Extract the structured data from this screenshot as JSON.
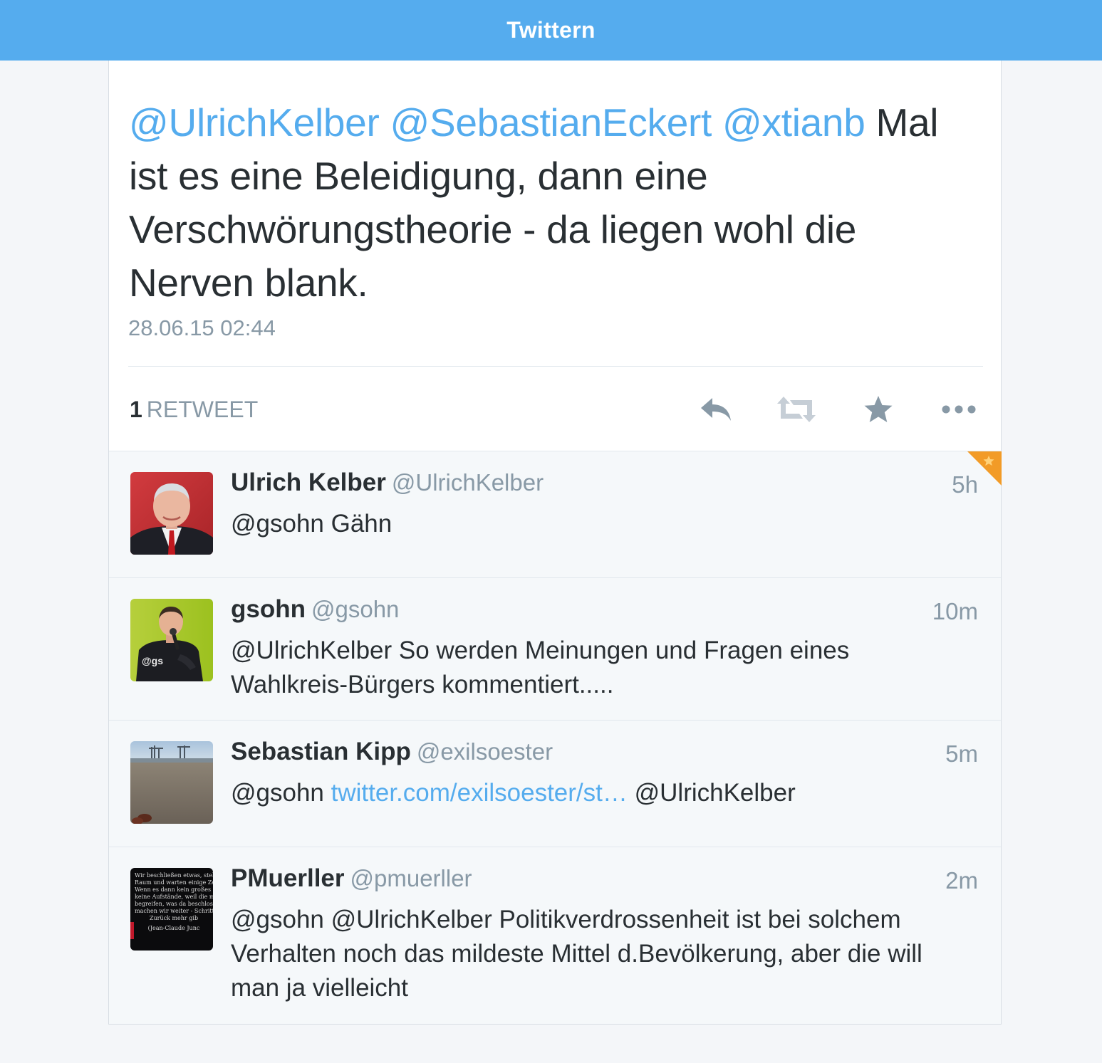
{
  "header": {
    "title": "Twittern",
    "color": "#55acee"
  },
  "main_tweet": {
    "mentions": [
      "@UlrichKelber",
      "@SebastianEckert",
      "@xtianb"
    ],
    "text": "Mal ist es eine Beleidigung, dann eine Verschwörungstheorie - da liegen wohl die Nerven blank.",
    "timestamp": "28.06.15 02:44",
    "retweet_count": "1",
    "retweet_label": "RETWEET"
  },
  "actions": [
    "reply-icon",
    "retweet-icon",
    "favorite-icon",
    "more-icon"
  ],
  "replies": [
    {
      "name": "Ulrich Kelber",
      "handle": "@UlrichKelber",
      "time": "5h",
      "text": "@gsohn Gähn",
      "favorited": true
    },
    {
      "name": "gsohn",
      "handle": "@gsohn",
      "time": "10m",
      "text": "@UlrichKelber So werden Meinungen und Fragen eines Wahlkreis-Bürgers kommentiert....."
    },
    {
      "name": "Sebastian Kipp",
      "handle": "@exilsoester",
      "time": "5m",
      "text_before": "@gsohn",
      "link": "twitter.com/exilsoester/st…",
      "text_after": "@UlrichKelber"
    },
    {
      "name": "PMuerller",
      "handle": "@pmuerller",
      "time": "2m",
      "text": "@gsohn @UlrichKelber Politikverdrossenheit ist bei solchem Verhalten noch das mildeste Mittel d.Bevölkerung, aber die will man ja vielleicht",
      "avatar_text": [
        "Wir beschließen etwas, stellen",
        "Raum und warten einige Zeit a",
        "Wenn es dann kein großes Ge",
        "keine Aufstände, weil die me",
        "begreifen, was da beschlosse",
        "machen wir weiter - Schritt für S",
        "Zurück mehr gib",
        "(Jean-Claude Junc"
      ]
    }
  ]
}
